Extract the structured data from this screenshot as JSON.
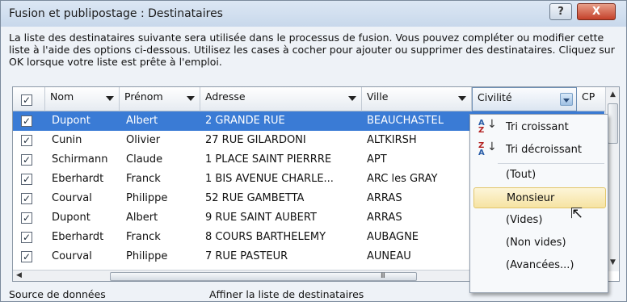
{
  "window": {
    "title": "Fusion et publipostage : Destinataires",
    "help_label": "?",
    "close_label": "X"
  },
  "intro_text": "La liste des destinataires suivante sera utilisée dans le processus de fusion. Vous pouvez compléter ou modifier cette liste à l'aide des options ci-dessous. Utilisez les cases à cocher pour ajouter ou supprimer des destinataires. Cliquez sur OK lorsque votre liste est prête à l'emploi.",
  "table": {
    "header_checkbox": "✓",
    "columns": [
      "Nom",
      "Prénom",
      "Adresse",
      "Ville",
      "Civilité",
      "CP"
    ],
    "rows": [
      {
        "check": "✓",
        "nom": "Dupont",
        "prenom": "Albert",
        "adresse": "2 GRANDE RUE",
        "ville": "BEAUCHASTEL",
        "selected": true
      },
      {
        "check": "✓",
        "nom": "Cunin",
        "prenom": "Olivier",
        "adresse": "27 RUE GILARDONI",
        "ville": "ALTKIRSH"
      },
      {
        "check": "✓",
        "nom": "Schirmann",
        "prenom": "Claude",
        "adresse": "1 PLACE SAINT PIERRRE",
        "ville": "APT"
      },
      {
        "check": "✓",
        "nom": "Eberhardt",
        "prenom": "Franck",
        "adresse": "1 BIS AVENUE CHARLE...",
        "ville": "ARC les GRAY"
      },
      {
        "check": "✓",
        "nom": "Courval",
        "prenom": "Philippe",
        "adresse": "52 RUE GAMBETTA",
        "ville": "ARRAS"
      },
      {
        "check": "✓",
        "nom": "Dupont",
        "prenom": "Albert",
        "adresse": "9 RUE SAINT AUBERT",
        "ville": "ARRAS"
      },
      {
        "check": "✓",
        "nom": "Eberhardt",
        "prenom": "Franck",
        "adresse": "8 COURS BARTHELEMY",
        "ville": "AUBAGNE"
      },
      {
        "check": "✓",
        "nom": "Courval",
        "prenom": "Philippe",
        "adresse": "7 RUE PASTEUR",
        "ville": "AUNEAU"
      }
    ],
    "hscroll_grip": "III"
  },
  "dropdown_menu": {
    "items": [
      {
        "label": "Tri croissant",
        "icon": "sort-ascending-icon",
        "icon_top": "A",
        "icon_bottom": "Z",
        "arrow": "↓"
      },
      {
        "label": "Tri décroissant",
        "icon": "sort-descending-icon",
        "icon_top": "Z",
        "icon_bottom": "A",
        "arrow": "↓"
      },
      {
        "label": "(Tout)"
      },
      {
        "label": "Monsieur",
        "highlighted": true
      },
      {
        "label": "(Vides)"
      },
      {
        "label": "(Non vides)"
      },
      {
        "label": "(Avancées...)"
      }
    ]
  },
  "footer": {
    "source_label": "Source de données",
    "refine_label": "Affiner la liste de destinataires"
  },
  "colors": {
    "selection": "#3a7bd5",
    "highlight": "#f6e3a2",
    "close_button": "#c4412a"
  }
}
